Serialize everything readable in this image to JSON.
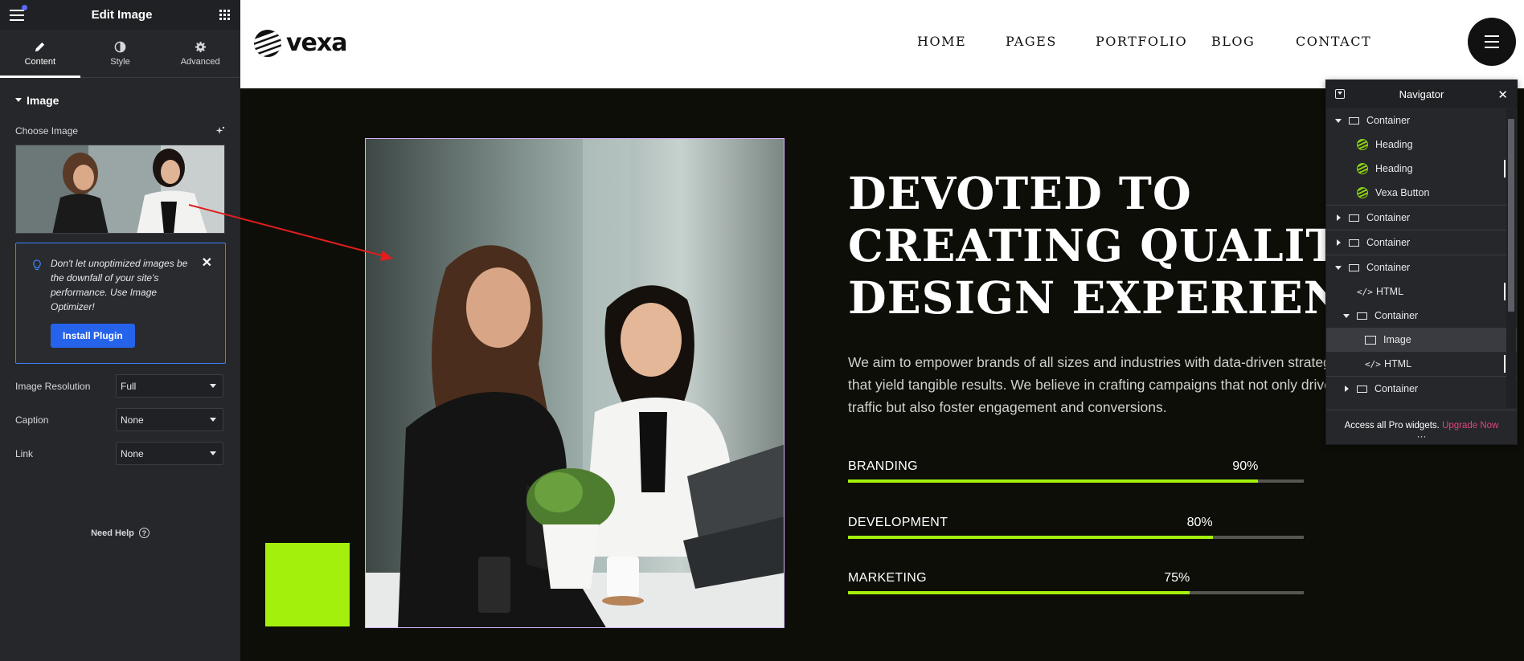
{
  "editor": {
    "title": "Edit Image",
    "tabs": [
      {
        "label": "Content",
        "icon": "pencil-icon"
      },
      {
        "label": "Style",
        "icon": "contrast-icon"
      },
      {
        "label": "Advanced",
        "icon": "gear-icon"
      }
    ],
    "section_title": "Image",
    "choose_image_label": "Choose Image",
    "notice": {
      "message": "Don't let unoptimized images be the downfall of your site's performance. Use Image Optimizer!",
      "button": "Install Plugin"
    },
    "controls": [
      {
        "label": "Image Resolution",
        "value": "Full"
      },
      {
        "label": "Caption",
        "value": "None"
      },
      {
        "label": "Link",
        "value": "None"
      }
    ],
    "need_help": "Need Help"
  },
  "site": {
    "logo_text": "vexa",
    "nav": [
      "HOME",
      "PAGES",
      "PORTFOLIO",
      "BLOG",
      "CONTACT"
    ],
    "headline": [
      "DEVOTED TO",
      "CREATING QUALITY",
      "DESIGN EXPERIENCE"
    ],
    "paragraph": [
      "We aim to empower brands of all sizes and industries with data-driven strategies",
      "that yield tangible results. We believe in crafting campaigns that not only drive",
      "traffic but also foster engagement and conversions."
    ],
    "skills": [
      {
        "label": "BRANDING",
        "percent_text": "90%",
        "value": 0.9
      },
      {
        "label": "DEVELOPMENT",
        "percent_text": "80%",
        "value": 0.8
      },
      {
        "label": "MARKETING",
        "percent_text": "75%",
        "value": 0.75
      }
    ],
    "accent_color": "#a3f00c"
  },
  "navigator": {
    "title": "Navigator",
    "items": [
      {
        "label": "Container",
        "type": "container"
      },
      {
        "label": "Heading",
        "type": "heading"
      },
      {
        "label": "Heading",
        "type": "heading"
      },
      {
        "label": "Vexa Button",
        "type": "heading"
      },
      {
        "label": "Container",
        "type": "container"
      },
      {
        "label": "Container",
        "type": "container"
      },
      {
        "label": "Container",
        "type": "container"
      },
      {
        "label": "HTML",
        "type": "html"
      },
      {
        "label": "Container",
        "type": "container"
      },
      {
        "label": "Image",
        "type": "image"
      },
      {
        "label": "HTML",
        "type": "html"
      },
      {
        "label": "Container",
        "type": "container"
      }
    ],
    "footer_text": "Access all Pro widgets.",
    "footer_link": "Upgrade Now"
  }
}
